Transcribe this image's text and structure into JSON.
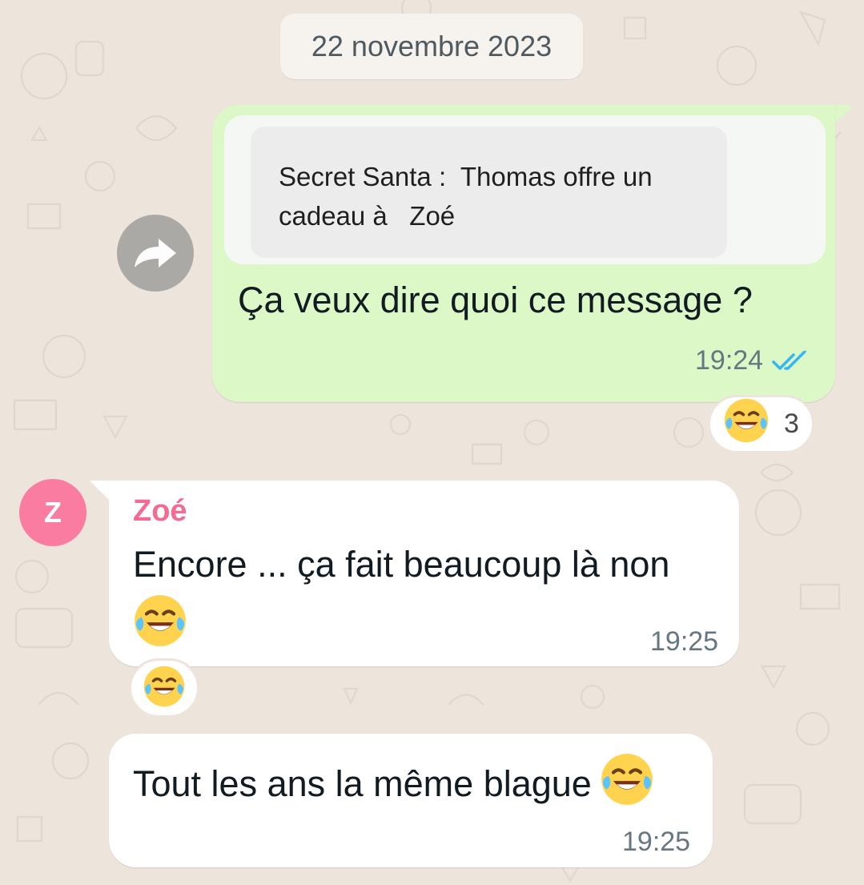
{
  "date_separator": "22 novembre 2023",
  "forward": {
    "icon": "forward-arrow-icon"
  },
  "outgoing_message": {
    "quoted_text": "Secret Santa :  Thomas offre un\ncadeau à   Zoé",
    "text": "Ça veux dire quoi ce message ?",
    "time": "19:24",
    "status_icon": "double-check-icon",
    "status_color": "#34b7f1"
  },
  "outgoing_reaction": {
    "emoji_icon": "face-with-tears-of-joy-icon",
    "count": "3"
  },
  "incoming_message_1": {
    "avatar_initial": "Z",
    "avatar_color": "#fb7ca1",
    "sender": "Zoé",
    "sender_color": "#f46a93",
    "text": "Encore ... ça fait beaucoup là non",
    "emoji_icon": "face-with-tears-of-joy-icon",
    "time": "19:25"
  },
  "incoming_reaction": {
    "emoji_icon": "face-with-tears-of-joy-icon"
  },
  "incoming_message_2": {
    "text": "Tout les ans la même blague",
    "emoji_icon": "face-with-tears-of-joy-icon",
    "time": "19:25"
  },
  "colors": {
    "chat_background": "#ede4dc",
    "outgoing_bubble": "#dcf8c6",
    "incoming_bubble": "#ffffff",
    "timestamp": "#667781"
  }
}
